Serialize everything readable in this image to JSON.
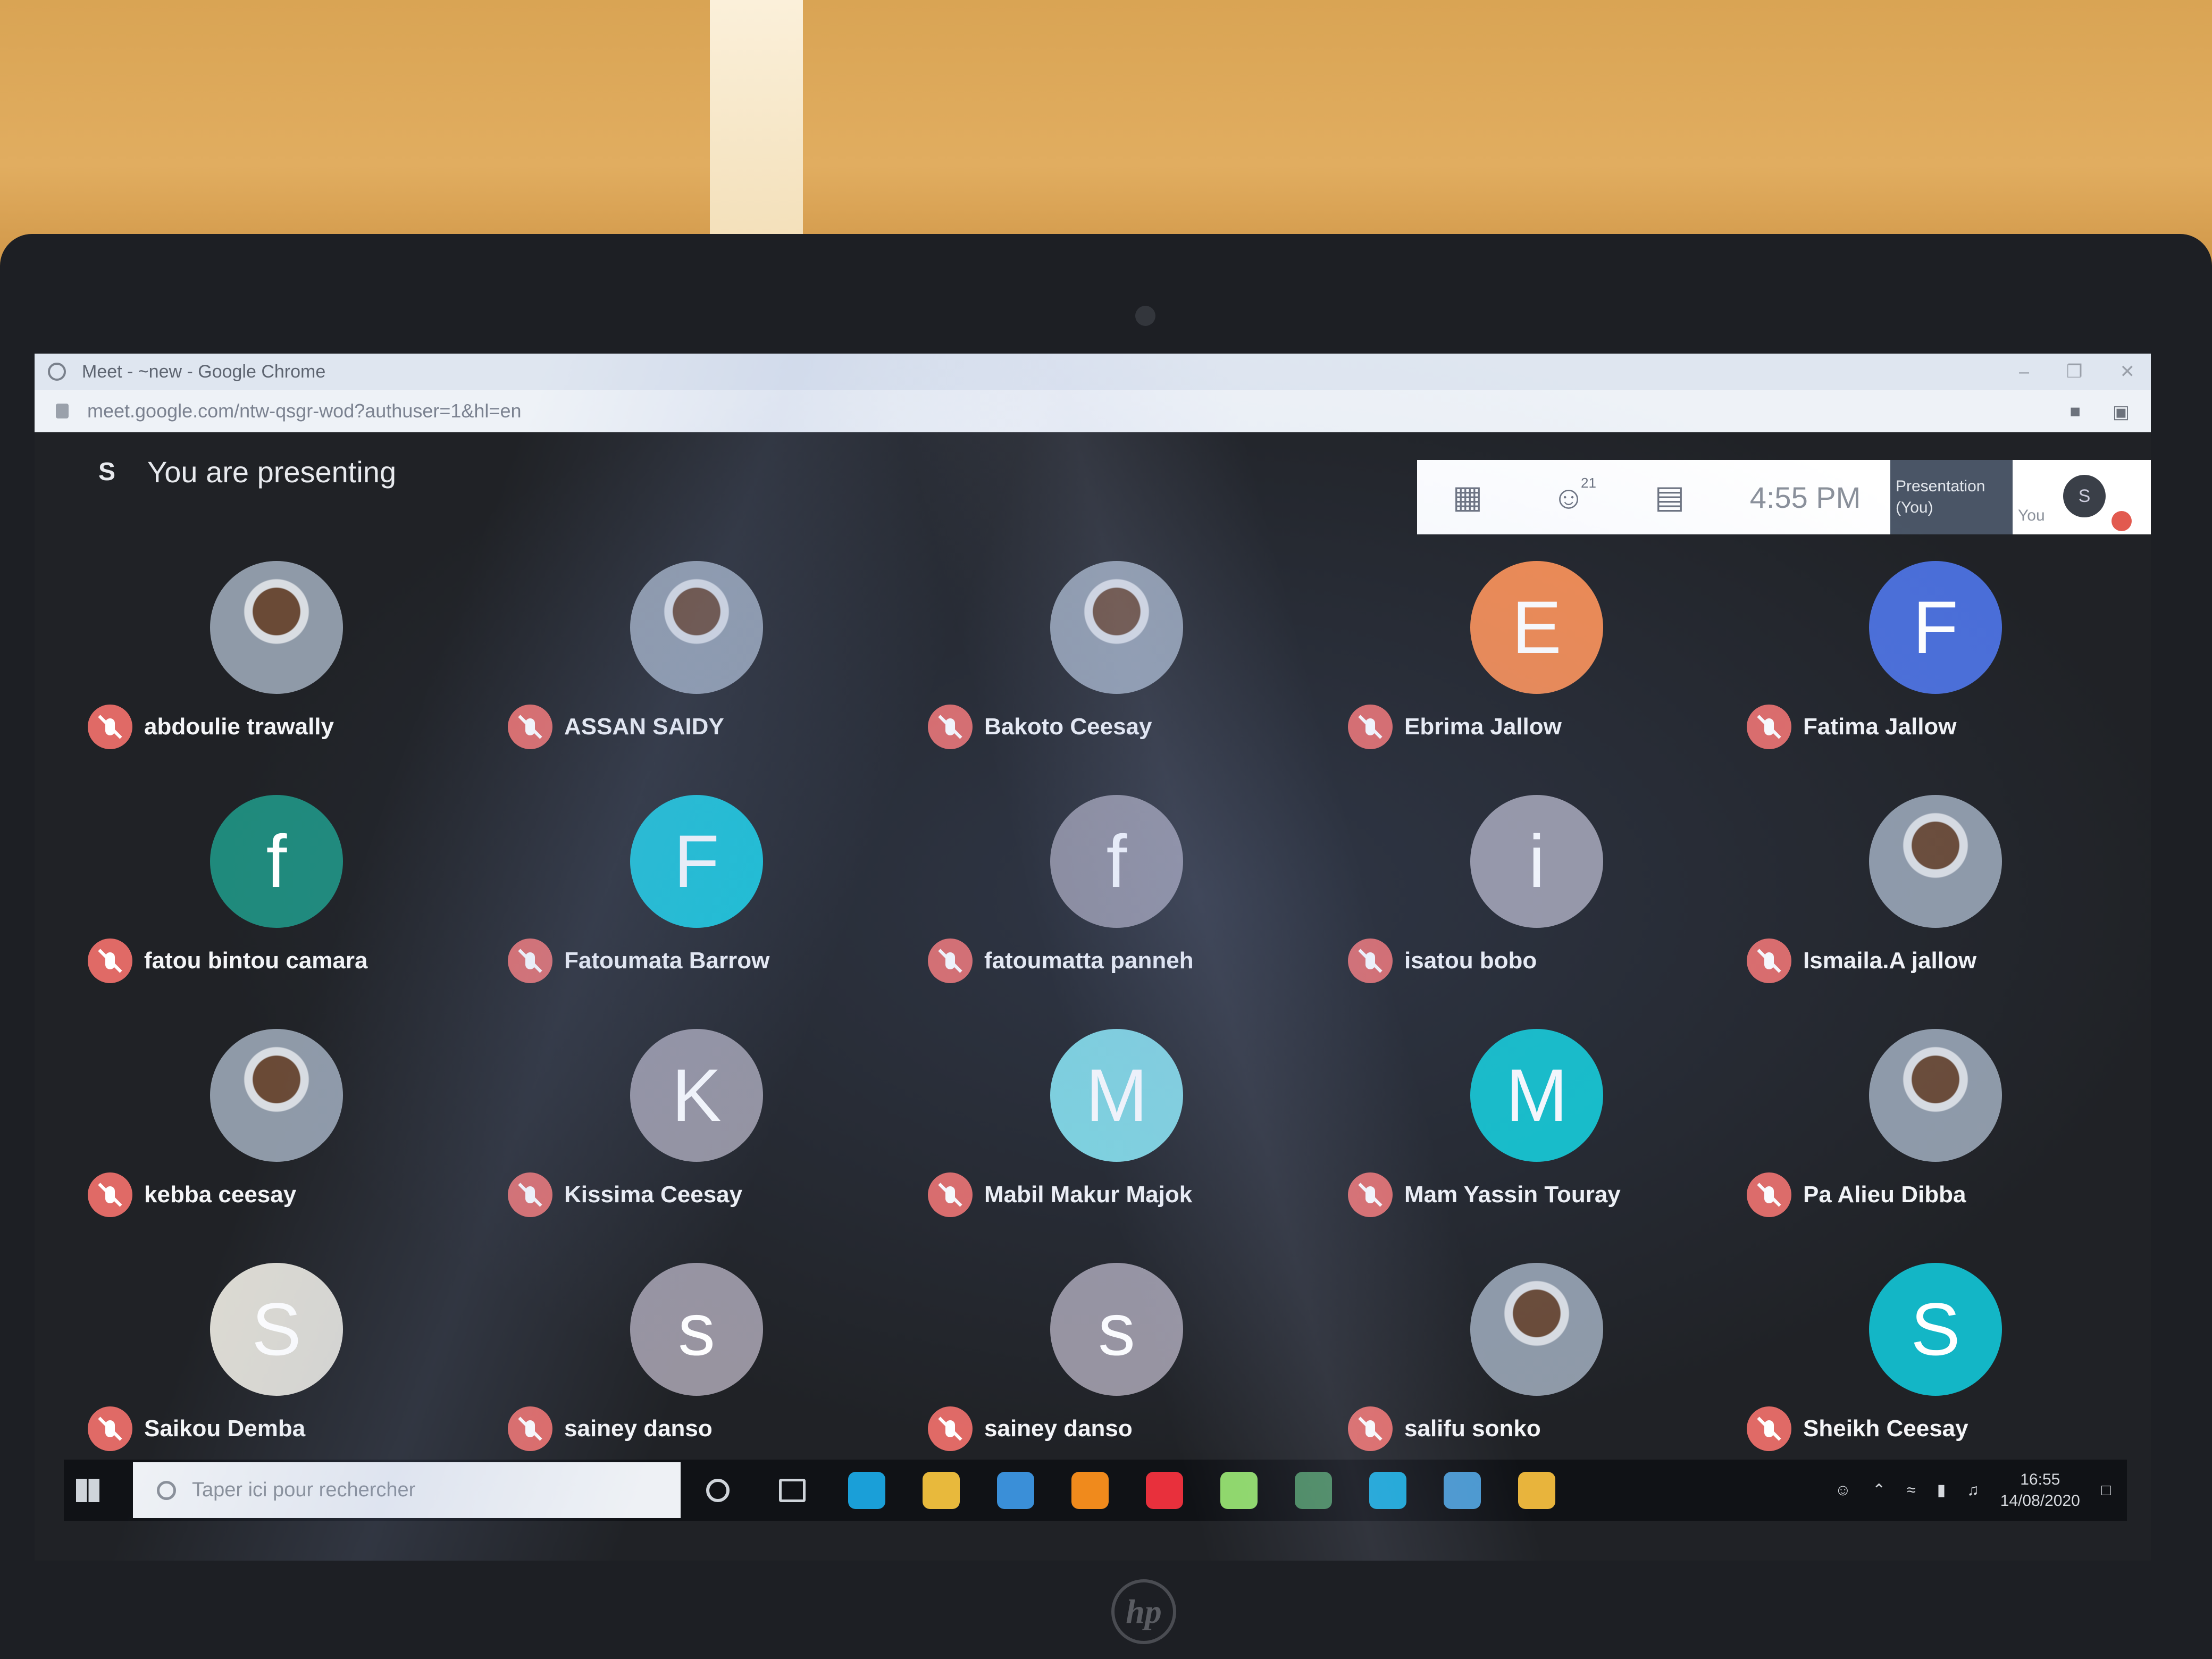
{
  "browser": {
    "window_title": "Meet - ~new - Google Chrome",
    "url": "meet.google.com/ntw-qsgr-wod?authuser=1&hl=en"
  },
  "meet": {
    "user_initial": "S",
    "presenting_text": "You are presenting",
    "participants_count": "21",
    "time": "4:55 PM",
    "presentation_label_line1": "Presentation",
    "presentation_label_line2": "(You)",
    "you_label": "You",
    "you_initial": "S"
  },
  "participants": [
    {
      "name": "abdoulie trawally",
      "initial": "",
      "color": "#8b8f96",
      "photo": true
    },
    {
      "name": "ASSAN SAIDY",
      "initial": "",
      "color": "#8b8f96",
      "photo": true
    },
    {
      "name": "Bakoto Ceesay",
      "initial": "",
      "color": "#8b8f96",
      "photo": true
    },
    {
      "name": "Ebrima Jallow",
      "initial": "E",
      "color": "#f0894f",
      "photo": false
    },
    {
      "name": "Fatima Jallow",
      "initial": "F",
      "color": "#4a6ed8",
      "photo": false
    },
    {
      "name": "fatou bintou camara",
      "initial": "f",
      "color": "#1f8a7c",
      "photo": false
    },
    {
      "name": "Fatoumata Barrow",
      "initial": "F",
      "color": "#12c2d4",
      "photo": false
    },
    {
      "name": "fatoumatta panneh",
      "initial": "f",
      "color": "#8e8b96",
      "photo": false
    },
    {
      "name": "isatou bobo",
      "initial": "i",
      "color": "#9a98a4",
      "photo": false
    },
    {
      "name": "Ismaila.A jallow",
      "initial": "",
      "color": "#8b8f96",
      "photo": true
    },
    {
      "name": "kebba ceesay",
      "initial": "",
      "color": "#8b8f96",
      "photo": true
    },
    {
      "name": "Kissima Ceesay",
      "initial": "K",
      "color": "#96939e",
      "photo": false
    },
    {
      "name": "Mabil Makur Majok",
      "initial": "M",
      "color": "#7fd6df",
      "photo": false
    },
    {
      "name": "Mam Yassin Touray",
      "initial": "M",
      "color": "#10bfc8",
      "photo": false
    },
    {
      "name": "Pa Alieu Dibba",
      "initial": "",
      "color": "#8b8f96",
      "photo": true
    },
    {
      "name": "Saikou Demba",
      "initial": "S",
      "color": "#dcdad2",
      "photo": false
    },
    {
      "name": "sainey danso",
      "initial": "s",
      "color": "#9894a0",
      "photo": false
    },
    {
      "name": "sainey danso",
      "initial": "s",
      "color": "#9894a0",
      "photo": false
    },
    {
      "name": "salifu sonko",
      "initial": "",
      "color": "#8b8f96",
      "photo": true
    },
    {
      "name": "Sheikh Ceesay",
      "initial": "S",
      "color": "#13b6c6",
      "photo": false
    }
  ],
  "taskbar": {
    "search_placeholder": "Taper ici pour rechercher",
    "time": "16:55",
    "date": "14/08/2020",
    "apps": [
      {
        "name": "edge-icon",
        "color": "#1a9fd8"
      },
      {
        "name": "file-explorer-icon",
        "color": "#e8b93c"
      },
      {
        "name": "store-icon",
        "color": "#3a8fd8"
      },
      {
        "name": "vlc-icon",
        "color": "#f08a1c"
      },
      {
        "name": "opera-icon",
        "color": "#e8303c"
      },
      {
        "name": "whatsapp-icon",
        "color": "#8fd86a"
      },
      {
        "name": "meet-app-icon",
        "color": "#4a8a60"
      },
      {
        "name": "skype-icon",
        "color": "#1aa8d8"
      },
      {
        "name": "notepad-icon",
        "color": "#4a98d0"
      },
      {
        "name": "chrome-icon",
        "color": "#e8b43c"
      }
    ]
  },
  "brand": {
    "laptop_logo": "hp"
  }
}
